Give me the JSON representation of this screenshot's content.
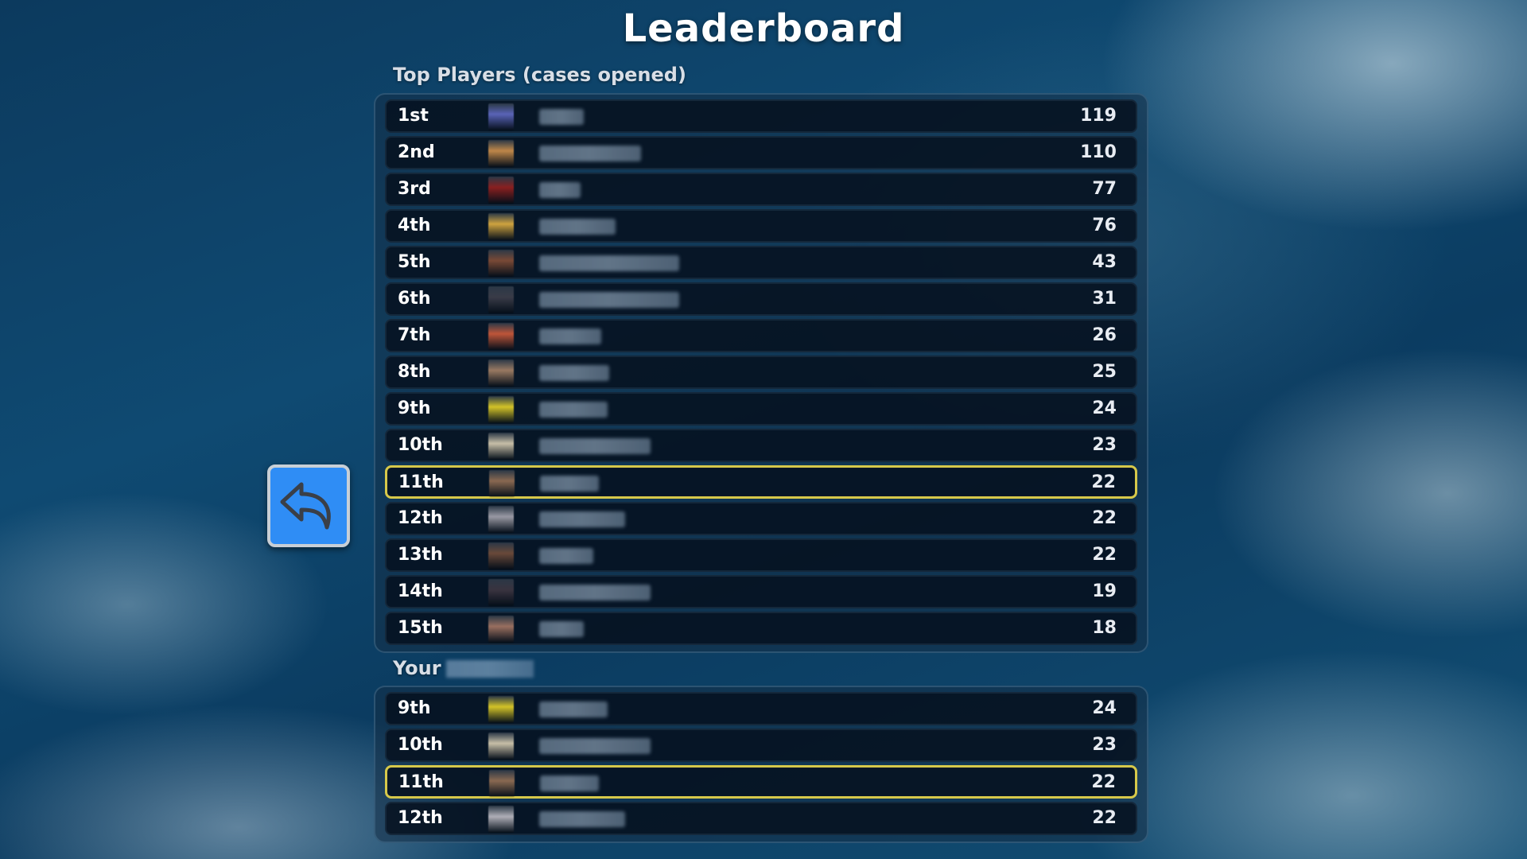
{
  "title": "Leaderboard",
  "top_section_label": "Top Players (cases opened)",
  "your_section_label": "Your",
  "back_button": {
    "icon": "back-arrow-icon"
  },
  "top_players": [
    {
      "rank": "1st",
      "score": "119",
      "avatar_color": "#5a64b8",
      "name_width": 56,
      "me": false
    },
    {
      "rank": "2nd",
      "score": "110",
      "avatar_color": "#c0884a",
      "name_width": 128,
      "me": false
    },
    {
      "rank": "3rd",
      "score": "77",
      "avatar_color": "#8a2020",
      "name_width": 52,
      "me": false
    },
    {
      "rank": "4th",
      "score": "76",
      "avatar_color": "#d0a440",
      "name_width": 96,
      "me": false
    },
    {
      "rank": "5th",
      "score": "43",
      "avatar_color": "#7a4a36",
      "name_width": 176,
      "me": false
    },
    {
      "rank": "6th",
      "score": "31",
      "avatar_color": "#3a3c48",
      "name_width": 176,
      "me": false
    },
    {
      "rank": "7th",
      "score": "26",
      "avatar_color": "#c0563a",
      "name_width": 78,
      "me": false
    },
    {
      "rank": "8th",
      "score": "25",
      "avatar_color": "#9a7a62",
      "name_width": 88,
      "me": false
    },
    {
      "rank": "9th",
      "score": "24",
      "avatar_color": "#d4c428",
      "name_width": 86,
      "me": false
    },
    {
      "rank": "10th",
      "score": "23",
      "avatar_color": "#c8c0a8",
      "name_width": 140,
      "me": false
    },
    {
      "rank": "11th",
      "score": "22",
      "avatar_color": "#8a6a52",
      "name_width": 74,
      "me": true
    },
    {
      "rank": "12th",
      "score": "22",
      "avatar_color": "#9a9aa4",
      "name_width": 108,
      "me": false
    },
    {
      "rank": "13th",
      "score": "22",
      "avatar_color": "#6a4a3a",
      "name_width": 68,
      "me": false
    },
    {
      "rank": "14th",
      "score": "19",
      "avatar_color": "#3a3440",
      "name_width": 140,
      "me": false
    },
    {
      "rank": "15th",
      "score": "18",
      "avatar_color": "#9a7060",
      "name_width": 56,
      "me": false
    }
  ],
  "your_position": [
    {
      "rank": "9th",
      "score": "24",
      "avatar_color": "#d4c428",
      "name_width": 86,
      "me": false
    },
    {
      "rank": "10th",
      "score": "23",
      "avatar_color": "#c8c0a8",
      "name_width": 140,
      "me": false
    },
    {
      "rank": "11th",
      "score": "22",
      "avatar_color": "#8a6a52",
      "name_width": 74,
      "me": true
    },
    {
      "rank": "12th",
      "score": "22",
      "avatar_color": "#b0b0b8",
      "name_width": 108,
      "me": false
    }
  ]
}
